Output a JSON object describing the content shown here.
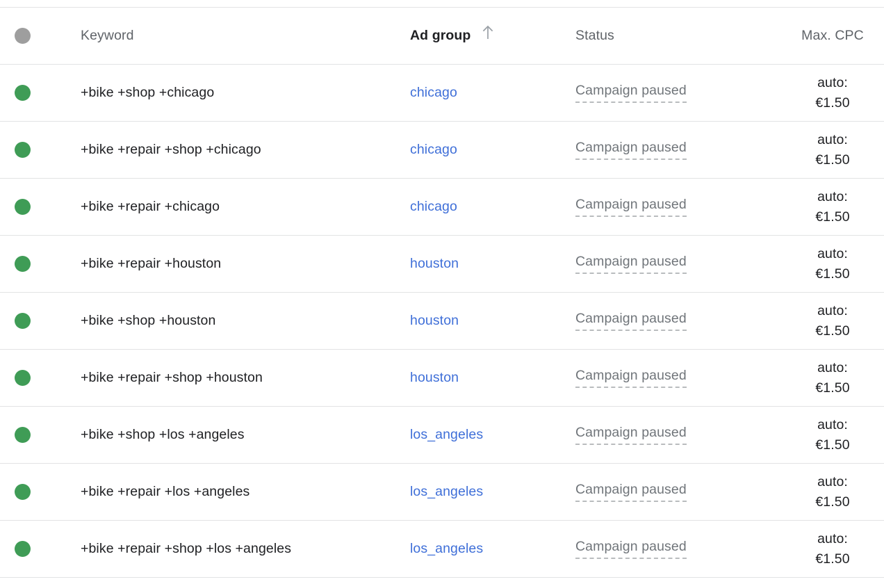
{
  "table": {
    "columns": [
      {
        "key": "select",
        "label": "",
        "icon": "status-dot-icon",
        "sorted": false
      },
      {
        "key": "keyword",
        "label": "Keyword",
        "sorted": false
      },
      {
        "key": "adgroup",
        "label": "Ad group",
        "sorted": true,
        "sort_direction": "ascending",
        "sort_icon": "arrow-up-icon"
      },
      {
        "key": "status",
        "label": "Status",
        "sorted": false
      },
      {
        "key": "cpc",
        "label": "Max. CPC",
        "sorted": false
      }
    ],
    "header": {
      "select_dot_color": "#9e9e9e",
      "keyword_label": "Keyword",
      "adgroup_label": "Ad group",
      "status_label": "Status",
      "cpc_label": "Max. CPC"
    },
    "colors": {
      "status_enabled_dot": "#3f9c56",
      "link": "#3f6fd8",
      "text_primary": "#202124",
      "text_secondary": "#5f6368",
      "status_muted": "#70757a",
      "row_divider": "#e2e3e4",
      "header_dot": "#9e9e9e"
    },
    "rows": [
      {
        "status_dot": "enabled",
        "keyword": "+bike +shop +chicago",
        "adgroup": "chicago",
        "status": "Campaign paused",
        "cpc": "auto:\n€1.50"
      },
      {
        "status_dot": "enabled",
        "keyword": "+bike +repair +shop +chicago",
        "adgroup": "chicago",
        "status": "Campaign paused",
        "cpc": "auto:\n€1.50"
      },
      {
        "status_dot": "enabled",
        "keyword": "+bike +repair +chicago",
        "adgroup": "chicago",
        "status": "Campaign paused",
        "cpc": "auto:\n€1.50"
      },
      {
        "status_dot": "enabled",
        "keyword": "+bike +repair +houston",
        "adgroup": "houston",
        "status": "Campaign paused",
        "cpc": "auto:\n€1.50"
      },
      {
        "status_dot": "enabled",
        "keyword": "+bike +shop +houston",
        "adgroup": "houston",
        "status": "Campaign paused",
        "cpc": "auto:\n€1.50"
      },
      {
        "status_dot": "enabled",
        "keyword": "+bike +repair +shop +houston",
        "adgroup": "houston",
        "status": "Campaign paused",
        "cpc": "auto:\n€1.50"
      },
      {
        "status_dot": "enabled",
        "keyword": "+bike +shop +los +angeles",
        "adgroup": "los_angeles",
        "status": "Campaign paused",
        "cpc": "auto:\n€1.50"
      },
      {
        "status_dot": "enabled",
        "keyword": "+bike +repair +los +angeles",
        "adgroup": "los_angeles",
        "status": "Campaign paused",
        "cpc": "auto:\n€1.50"
      },
      {
        "status_dot": "enabled",
        "keyword": "+bike +repair +shop +los +angeles",
        "adgroup": "los_angeles",
        "status": "Campaign paused",
        "cpc": "auto:\n€1.50"
      }
    ]
  }
}
